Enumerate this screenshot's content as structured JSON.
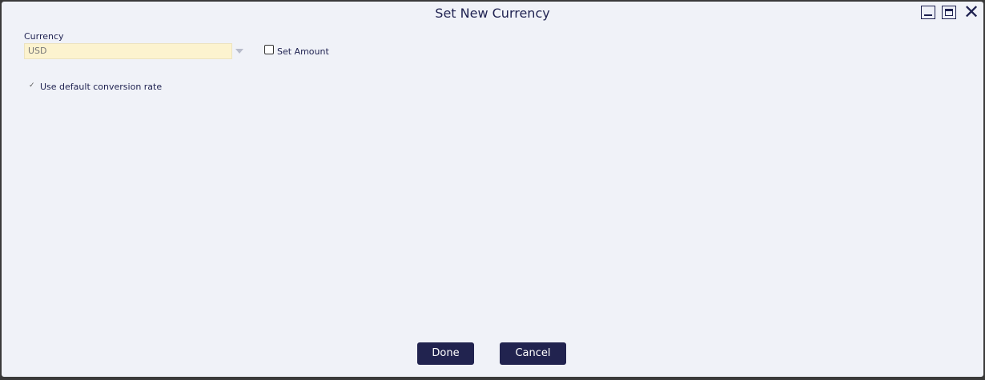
{
  "dialog": {
    "title": "Set New Currency",
    "window_controls": {
      "minimize_icon": "minimize-icon",
      "maximize_icon": "maximize-icon",
      "close_icon": "close-icon",
      "close_glyph": "✕"
    }
  },
  "form": {
    "currency_label": "Currency",
    "currency_value": "USD",
    "set_amount_label": "Set Amount",
    "set_amount_checked": false,
    "conversion_label": "Use default conversion rate",
    "conversion_check_glyph": "✓",
    "conversion_checked": true
  },
  "buttons": {
    "done_label": "Done",
    "cancel_label": "Cancel"
  },
  "colors": {
    "accent": "#21234f",
    "dialog_bg": "#f0f2f8",
    "select_bg": "#fcf3cf"
  }
}
